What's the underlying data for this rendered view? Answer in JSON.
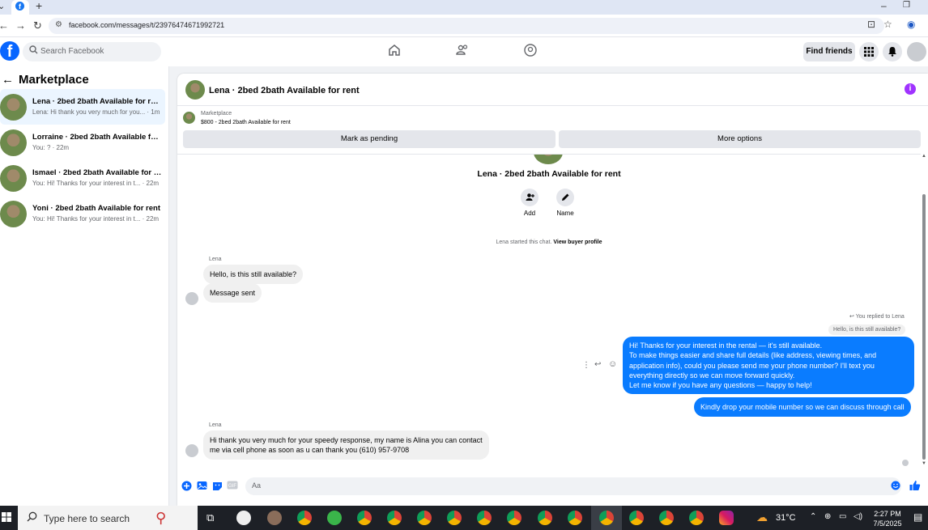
{
  "browser": {
    "url": "facebook.com/messages/t/23976474671992721",
    "new_tab": "+",
    "minimize": "–",
    "restore": "❐"
  },
  "fb": {
    "logo_letter": "f",
    "search_placeholder": "Search Facebook",
    "find_friends": "Find friends"
  },
  "marketplace": {
    "title": "Marketplace",
    "conversations": [
      {
        "name": "Lena · 2bed 2bath Available for rent",
        "preview": "Lena: Hi thank you very much for you... · 1m",
        "selected": true
      },
      {
        "name": "Lorraine · 2bed 2bath Available for...",
        "preview": "You: ? · 22m",
        "selected": false
      },
      {
        "name": "Ismael · 2bed 2bath Available for r...",
        "preview": "You: Hi! Thanks for your interest in t... · 22m",
        "selected": false
      },
      {
        "name": "Yoni · 2bed 2bath Available for rent",
        "preview": "You: Hi! Thanks for your interest in t... · 22m",
        "selected": false
      }
    ]
  },
  "chat": {
    "header_title": "Lena · 2bed 2bath Available for rent",
    "mp_label": "Marketplace",
    "mp_listing": "$800 - 2bed 2bath Available for rent",
    "mark_pending": "Mark as pending",
    "more_options": "More options",
    "thread_title": "Lena · 2bed 2bath Available for rent",
    "add_label": "Add",
    "name_label": "Name",
    "started_text": "Lena started this chat.",
    "view_buyer": "View buyer profile",
    "sender1": "Lena",
    "msg1": "Hello, is this still available?",
    "msg2": "Message sent",
    "replied_to": "You replied to Lena",
    "quoted": "Hello, is this still available?",
    "out_msg_lines": [
      "Hi! Thanks for your interest in the rental — it's still available.",
      "To make things easier and share full details (like address, viewing times, and",
      "application info), could you please send me your phone number? I'll text you",
      "everything directly so we can move forward quickly.",
      "Let me know if you have any questions — happy to help!"
    ],
    "out_msg2": "Kindly drop your mobile number so we can discuss through call",
    "sender2": "Lena",
    "in_msg3_lines": [
      "Hi thank you very much for your speedy response, my name is Alina you can contact",
      "me via cell phone as soon as u can thank you (610) 957-9708"
    ],
    "composer_placeholder": "Aa"
  },
  "taskbar": {
    "search_placeholder": "Type here to search",
    "temperature": "31°C",
    "time": "2:27 PM",
    "date": "7/5/2025"
  },
  "colors": {
    "fb_blue": "#0866ff",
    "bubble_out": "#0a7cff",
    "info_purple": "#a033ff"
  }
}
